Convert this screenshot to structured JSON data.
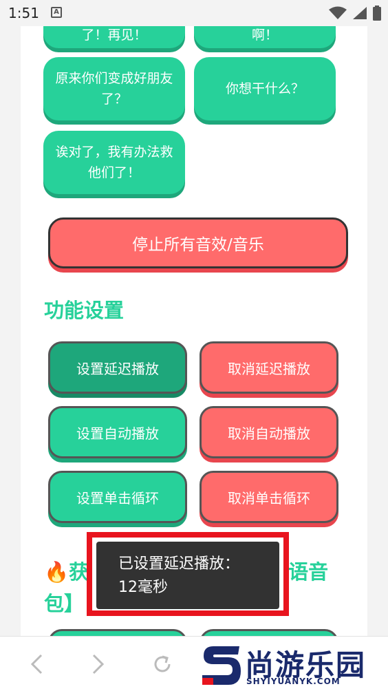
{
  "status_bar": {
    "time": "1:51",
    "notification_letter": "A",
    "icons": [
      "wifi-icon",
      "signal-icon",
      "battery-icon"
    ]
  },
  "sound_buttons": [
    {
      "label": "了！再见！"
    },
    {
      "label": "啊！"
    },
    {
      "label": "原来你们变成好朋友了？"
    },
    {
      "label": "你想干什么？"
    },
    {
      "label": "诶对了，我有办法救他们了！"
    }
  ],
  "stop_button": {
    "label": "停止所有音效/音乐"
  },
  "settings": {
    "title": "功能设置",
    "buttons": [
      {
        "label": "设置延迟播放",
        "state": "active"
      },
      {
        "label": "取消延迟播放"
      },
      {
        "label": "设置自动播放"
      },
      {
        "label": "取消自动播放"
      },
      {
        "label": "设置单击循环"
      },
      {
        "label": "取消单击循环"
      }
    ]
  },
  "section2": {
    "title": "🔥获取更多语音包】",
    "title_visible_start": "🔥获",
    "title_visible_end": "语音",
    "title_line2": "包】"
  },
  "toast": {
    "line1": "已设置延迟播放：",
    "line2": "12毫秒"
  },
  "bottom_bar": {
    "icons": [
      "back-icon",
      "forward-icon",
      "reload-icon"
    ],
    "brand_name": "尚游乐园",
    "brand_url": "SHYIYUANYK.COM"
  },
  "colors": {
    "green": "#27d19a",
    "green_shadow": "#1ea77b",
    "red": "#ff6b6b",
    "toast_bg": "#323232",
    "highlight": "#e8141e",
    "brand": "#1a2a6c"
  }
}
